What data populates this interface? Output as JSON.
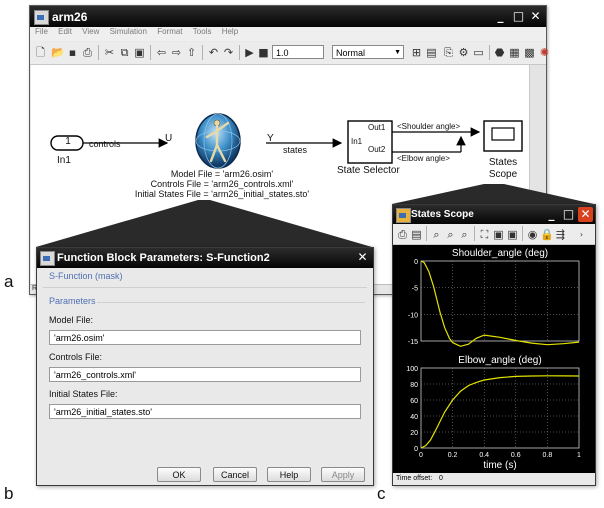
{
  "panel_labels": {
    "a": "a",
    "b": "b",
    "c": "c"
  },
  "simulink": {
    "title": "arm26",
    "menus": [
      "File",
      "Edit",
      "View",
      "Simulation",
      "Format",
      "Tools",
      "Help"
    ],
    "stop_time": "1.0",
    "mode": "Normal",
    "status_text": "Re",
    "blocks": {
      "inport_number": "1",
      "inport_name": "In1",
      "signal_controls": "controls",
      "sfunc_input": "U",
      "sfunc_output": "Y",
      "signal_states": "states",
      "model_file_line": "Model File = 'arm26.osim'",
      "controls_file_line": "Controls File = 'arm26_controls.xml'",
      "initial_states_line": "Initial States File = 'arm26_initial_states.sto'",
      "selector_in": "In1",
      "selector_out1": "Out1",
      "selector_out2": "Out2",
      "selector_name": "State Selector",
      "signal_shoulder": "<Shoulder angle>",
      "signal_elbow": "<Elbow angle>",
      "scope_name_line1": "States",
      "scope_name_line2": "Scope"
    }
  },
  "dialog": {
    "title": "Function Block Parameters: S-Function2",
    "mask_label": "S-Function (mask)",
    "parameters_label": "Parameters",
    "model_file_label": "Model File:",
    "model_file_value": "'arm26.osim'",
    "controls_file_label": "Controls File:",
    "controls_file_value": "'arm26_controls.xml'",
    "initial_states_label": "Initial States File:",
    "initial_states_value": "'arm26_initial_states.sto'",
    "buttons": {
      "ok": "OK",
      "cancel": "Cancel",
      "help": "Help",
      "apply": "Apply"
    }
  },
  "scope": {
    "title": "States Scope",
    "time_offset_label": "Time offset:",
    "time_offset_value": "0",
    "bg_color": "#000000",
    "line_color": "#e3e300",
    "grid_color": "#9a9a9a"
  },
  "chart_data": [
    {
      "type": "line",
      "title": "Shoulder_angle (deg)",
      "xlabel": "",
      "ylabel": "",
      "xlim": [
        0,
        1
      ],
      "ylim": [
        -15,
        0
      ],
      "xticks": [
        0,
        0.2,
        0.4,
        0.6,
        0.8,
        1
      ],
      "yticks": [
        0,
        -5,
        -10,
        -15
      ],
      "grid": true,
      "series": [
        {
          "x": [
            0,
            0.02,
            0.05,
            0.08,
            0.1,
            0.12,
            0.15,
            0.18,
            0.2,
            0.25,
            0.3,
            0.35,
            0.4,
            0.5,
            0.6,
            0.7,
            0.8,
            0.9,
            1.0
          ],
          "values": [
            0,
            -0.3,
            -2.0,
            -4.8,
            -7.2,
            -9.6,
            -12.5,
            -14.5,
            -15.3,
            -16.0,
            -15.6,
            -14.5,
            -13.9,
            -14.3,
            -14.9,
            -15.4,
            -15.7,
            -15.5,
            -15.2
          ]
        }
      ]
    },
    {
      "type": "line",
      "title": "Elbow_angle (deg)",
      "xlabel": "time (s)",
      "ylabel": "",
      "xlim": [
        0,
        1
      ],
      "ylim": [
        0,
        100
      ],
      "xticks": [
        0,
        0.2,
        0.4,
        0.6,
        0.8,
        1
      ],
      "xticklabels": [
        "0",
        "0.2",
        "0.4",
        "0.6",
        "0.8",
        "1"
      ],
      "yticks": [
        0,
        20,
        40,
        60,
        80,
        100
      ],
      "grid": true,
      "series": [
        {
          "x": [
            0,
            0.03,
            0.06,
            0.1,
            0.15,
            0.2,
            0.25,
            0.3,
            0.35,
            0.4,
            0.5,
            0.6,
            0.7,
            0.8,
            0.9,
            1.0
          ],
          "values": [
            0,
            3,
            10,
            25,
            45,
            60,
            71,
            78,
            82,
            85,
            88,
            89.5,
            90,
            90.2,
            90.1,
            90
          ]
        }
      ]
    }
  ]
}
